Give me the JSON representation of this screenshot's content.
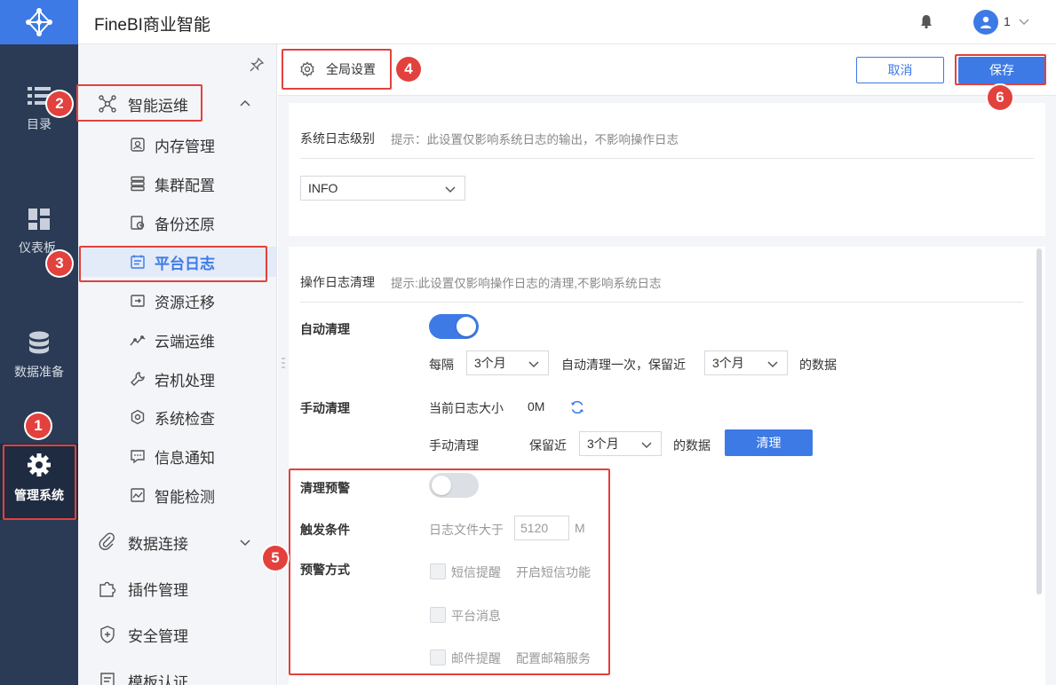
{
  "header": {
    "app_title": "FineBI商业智能",
    "user_name": "1"
  },
  "rail": {
    "items": [
      {
        "label": "目录"
      },
      {
        "label": "仪表板"
      },
      {
        "label": "数据准备"
      },
      {
        "label": "管理系统"
      }
    ]
  },
  "subnav": {
    "groups": [
      {
        "label": "智能运维"
      },
      {
        "label": "数据连接"
      },
      {
        "label": "插件管理"
      },
      {
        "label": "安全管理"
      },
      {
        "label": "模板认证"
      }
    ],
    "items": [
      {
        "label": "内存管理"
      },
      {
        "label": "集群配置"
      },
      {
        "label": "备份还原"
      },
      {
        "label": "平台日志"
      },
      {
        "label": "资源迁移"
      },
      {
        "label": "云端运维"
      },
      {
        "label": "宕机处理"
      },
      {
        "label": "系统检查"
      },
      {
        "label": "信息通知"
      },
      {
        "label": "智能检测"
      }
    ]
  },
  "topbar": {
    "tab_label": "全局设置",
    "cancel_label": "取消",
    "save_label": "保存"
  },
  "system_log": {
    "title": "系统日志级别",
    "hint": "提示：此设置仅影响系统日志的输出，不影响操作日志",
    "level_value": "INFO"
  },
  "op_log": {
    "title": "操作日志清理",
    "hint": "提示:此设置仅影响操作日志的清理,不影响系统日志",
    "auto_clean_label": "自动清理",
    "auto_clean_on": true,
    "interval_prefix": "每隔",
    "interval_value": "3个月",
    "interval_middle": "自动清理一次，保留近",
    "keep_value": "3个月",
    "interval_suffix": "的数据",
    "manual_clean_label": "手动清理",
    "current_size_label": "当前日志大小",
    "current_size_value": "0M",
    "manual_row_label": "手动清理",
    "keep_prefix": "保留近",
    "manual_keep_value": "3个月",
    "manual_suffix": "的数据",
    "clean_button": "清理",
    "warn_label": "清理预警",
    "warn_on": false,
    "trigger_label": "触发条件",
    "trigger_text": "日志文件大于",
    "trigger_value": "5120",
    "trigger_unit": "M",
    "warn_method_label": "预警方式",
    "methods": [
      {
        "label": "短信提醒",
        "extra": "开启短信功能"
      },
      {
        "label": "平台消息",
        "extra": ""
      },
      {
        "label": "邮件提醒",
        "extra": "配置邮箱服务"
      }
    ]
  },
  "annotations": [
    "1",
    "2",
    "3",
    "4",
    "5",
    "6"
  ],
  "colors": {
    "accent": "#3d7ae6",
    "rail": "#2b3b55",
    "annotation": "#e2413d"
  }
}
